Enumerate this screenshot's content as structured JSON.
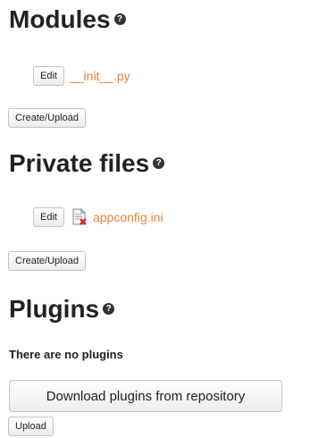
{
  "modules": {
    "title": "Modules",
    "help_icon": "question-circle-icon",
    "files": [
      {
        "edit_label": "Edit",
        "name": "__init__.py",
        "icon": ""
      }
    ],
    "create_label": "Create/Upload"
  },
  "private_files": {
    "title": "Private files",
    "help_icon": "question-circle-icon",
    "files": [
      {
        "edit_label": "Edit",
        "name": "appconfig.ini",
        "icon": "document-delete-icon"
      }
    ],
    "create_label": "Create/Upload"
  },
  "plugins": {
    "title": "Plugins",
    "help_icon": "question-circle-icon",
    "empty_text": "There are no plugins",
    "download_label": "Download plugins from repository",
    "upload_label": "Upload"
  },
  "colors": {
    "link": "#e8803a",
    "text": "#222222",
    "button_border": "#c4c4c4",
    "delete_mark": "#d9262a"
  }
}
